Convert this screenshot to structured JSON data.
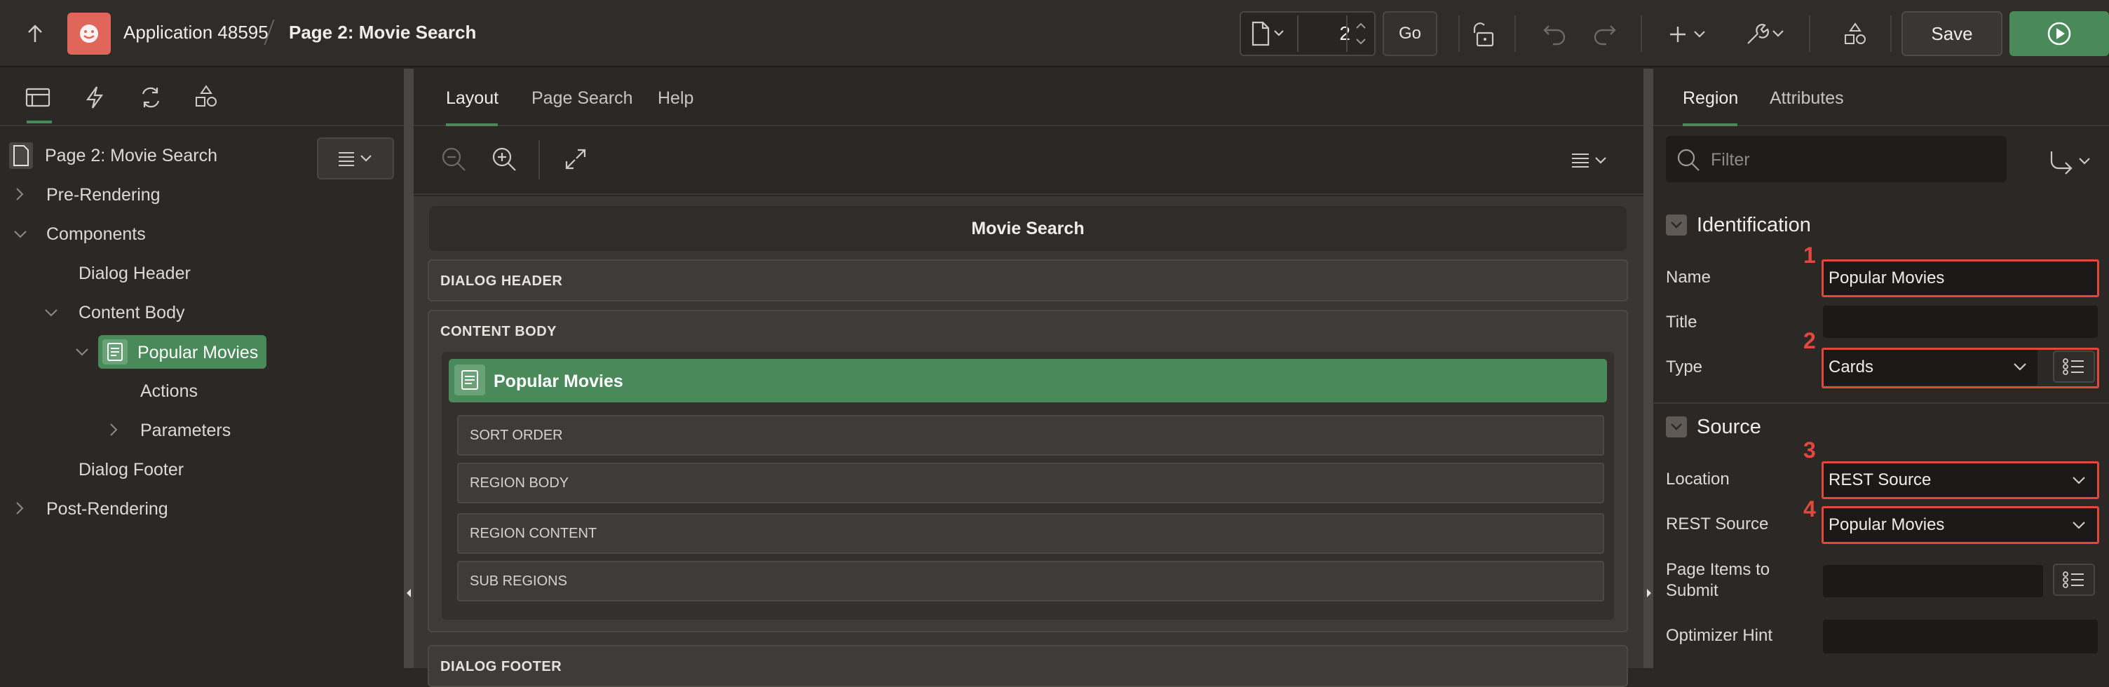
{
  "header": {
    "app_name": "Application 48595",
    "page_name": "Page 2: Movie Search",
    "page_number": "2",
    "go_label": "Go",
    "save_label": "Save"
  },
  "left_panel": {
    "tree": {
      "root": "Page 2: Movie Search",
      "pre_rendering": "Pre-Rendering",
      "components": "Components",
      "dialog_header": "Dialog Header",
      "content_body": "Content Body",
      "popular_movies": "Popular Movies",
      "actions": "Actions",
      "parameters": "Parameters",
      "dialog_footer": "Dialog Footer",
      "post_rendering": "Post-Rendering"
    }
  },
  "center": {
    "tabs": [
      "Layout",
      "Page Search",
      "Help"
    ],
    "canvas": {
      "title": "Movie Search",
      "dialog_header": "DIALOG HEADER",
      "content_body": "CONTENT BODY",
      "region_title": "Popular Movies",
      "sub_rows": [
        "SORT ORDER",
        "REGION BODY",
        "REGION CONTENT",
        "SUB REGIONS"
      ],
      "dialog_footer": "DIALOG FOOTER"
    }
  },
  "right_panel": {
    "tabs": [
      "Region",
      "Attributes"
    ],
    "filter_placeholder": "Filter",
    "identification": {
      "heading": "Identification",
      "name_label": "Name",
      "name_value": "Popular Movies",
      "title_label": "Title",
      "title_value": "",
      "type_label": "Type",
      "type_value": "Cards"
    },
    "source": {
      "heading": "Source",
      "location_label": "Location",
      "location_value": "REST Source",
      "rest_source_label": "REST Source",
      "rest_source_value": "Popular Movies",
      "page_items_label_1": "Page Items to",
      "page_items_label_2": "Submit",
      "optimizer_label": "Optimizer Hint"
    },
    "annotations": [
      "1",
      "2",
      "3",
      "4"
    ]
  },
  "colors": {
    "accent_green": "#4a8a5a",
    "annotation_red": "#e2483c",
    "app_icon": "#e0655a"
  }
}
